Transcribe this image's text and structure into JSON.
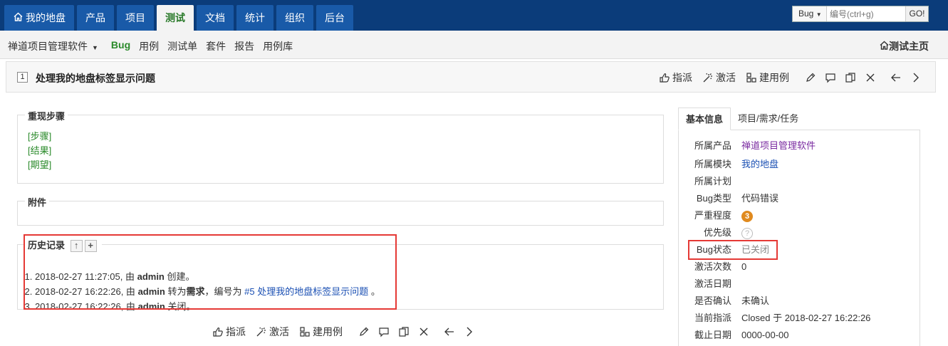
{
  "topnav": {
    "tabs": [
      {
        "label": "我的地盘",
        "icon": "home-icon",
        "active": false
      },
      {
        "label": "产品",
        "active": false
      },
      {
        "label": "项目",
        "active": false
      },
      {
        "label": "测试",
        "active": true
      },
      {
        "label": "文档",
        "active": false
      },
      {
        "label": "统计",
        "active": false
      },
      {
        "label": "组织",
        "active": false
      },
      {
        "label": "后台",
        "active": false
      }
    ],
    "search": {
      "type": "Bug",
      "placeholder": "编号(ctrl+g)",
      "go": "GO!"
    }
  },
  "subnav": {
    "product": "禅道项目管理软件",
    "items": [
      "Bug",
      "用例",
      "测试单",
      "套件",
      "报告",
      "用例库"
    ],
    "active": "Bug",
    "home_link": "测试主页"
  },
  "bug": {
    "id": "1",
    "title": "处理我的地盘标签显示问题"
  },
  "actions": {
    "assign": "指派",
    "activate": "激活",
    "create_case": "建用例"
  },
  "steps": {
    "legend": "重现步骤",
    "lines": [
      "[步骤]",
      "[结果]",
      "[期望]"
    ]
  },
  "files": {
    "legend": "附件"
  },
  "history": {
    "legend": "历史记录",
    "entries": [
      {
        "pre": "2018-02-27 11:27:05, 由 ",
        "user": "admin",
        "post": " 创建。"
      },
      {
        "pre": "2018-02-27 16:22:26, 由 ",
        "user": "admin",
        "mid": " 转为",
        "target": "需求",
        "post2": "，编号为 ",
        "link": "#5 处理我的地盘标签显示问题",
        "end": " 。"
      },
      {
        "pre": "2018-02-27 16:22:26, 由 ",
        "user": "admin",
        "post": " 关闭。"
      }
    ]
  },
  "side": {
    "tabs": [
      "基本信息",
      "项目/需求/任务"
    ],
    "fields": [
      {
        "label": "所属产品",
        "value": "禅道项目管理软件",
        "style": "purple"
      },
      {
        "label": "所属模块",
        "value": "我的地盘",
        "style": "link"
      },
      {
        "label": "所属计划",
        "value": ""
      },
      {
        "label": "Bug类型",
        "value": "代码错误"
      },
      {
        "label": "严重程度",
        "value": "3",
        "style": "sev"
      },
      {
        "label": "优先级",
        "value": "?",
        "style": "pri"
      },
      {
        "label": "Bug状态",
        "value": "已关闭",
        "style": "muted"
      },
      {
        "label": "激活次数",
        "value": "0"
      },
      {
        "label": "激活日期",
        "value": ""
      },
      {
        "label": "是否确认",
        "value": "未确认"
      },
      {
        "label": "当前指派",
        "value": "Closed 于 2018-02-27 16:22:26"
      },
      {
        "label": "截止日期",
        "value": "0000-00-00"
      }
    ]
  },
  "colors": {
    "topnav": "#0b3c7a",
    "tab": "#195aa8",
    "active_tab_text": "#2a7a2a",
    "highlight": "#e53935"
  }
}
